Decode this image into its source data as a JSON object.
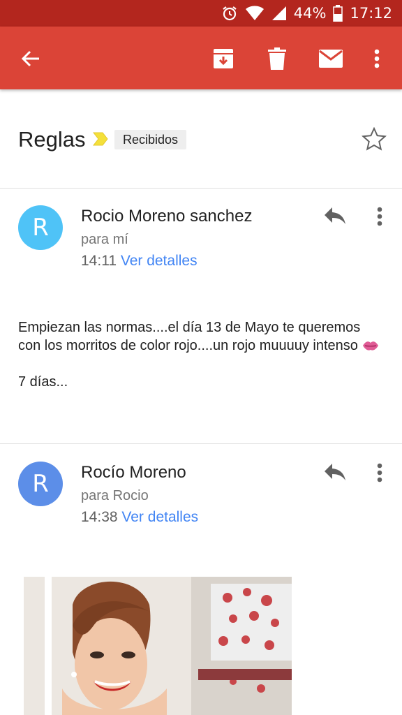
{
  "status_bar": {
    "battery": "44%",
    "time": "17:12"
  },
  "toolbar": {
    "icons": [
      "back-arrow-icon",
      "archive-icon",
      "delete-icon",
      "mark-unread-icon",
      "more-vert-icon"
    ]
  },
  "thread": {
    "subject": "Reglas",
    "label": "Recibidos",
    "starred": false
  },
  "messages": [
    {
      "avatar_letter": "R",
      "avatar_color": "#4fc3f7",
      "sender": "Rocio Moreno sanchez",
      "recipient": "para mí",
      "time": "14:11",
      "details_link": "Ver detalles",
      "body_line1": "Empiezan las normas....el día 13 de Mayo te queremos con los morritos de color rojo....un rojo muuuuy intenso",
      "body_line2": "7 días..."
    },
    {
      "avatar_letter": "R",
      "avatar_color": "#5c8ee8",
      "sender": "Rocío Moreno",
      "recipient": "para Rocio",
      "time": "14:38",
      "details_link": "Ver detalles",
      "attachment": "photo"
    }
  ],
  "colors": {
    "status_bar": "#b3261e",
    "app_bar": "#db4437",
    "link": "#4285f4"
  }
}
